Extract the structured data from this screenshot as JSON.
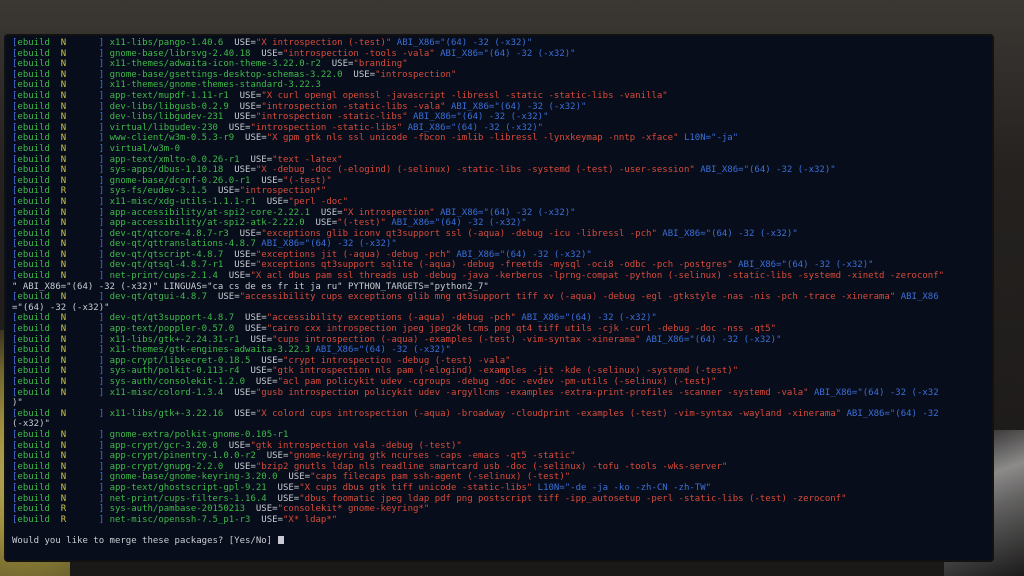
{
  "lines": [
    {
      "flag": "N",
      "pkg": "x11-libs/pango-1.40.6",
      "use": "\"X introspection (-test)\"",
      "abi": "ABI_X86=\"(64) -32 (-x32)\""
    },
    {
      "flag": "N",
      "pkg": "gnome-base/librsvg-2.40.18",
      "use": "\"introspection -tools -vala\"",
      "abi": "ABI_X86=\"(64) -32 (-x32)\""
    },
    {
      "flag": "N",
      "pkg": "x11-themes/adwaita-icon-theme-3.22.0-r2",
      "use": "\"branding\"",
      "abi": ""
    },
    {
      "flag": "N",
      "pkg": "gnome-base/gsettings-desktop-schemas-3.22.0",
      "use": "\"introspection\"",
      "abi": ""
    },
    {
      "flag": "N",
      "pkg": "x11-themes/gnome-themes-standard-3.22.3",
      "use": "",
      "abi": ""
    },
    {
      "flag": "N",
      "pkg": "app-text/mupdf-1.11-r1",
      "use": "\"X curl opengl openssl -javascript -libressl -static -static-libs -vanilla\"",
      "abi": ""
    },
    {
      "flag": "N",
      "pkg": "dev-libs/libgusb-0.2.9",
      "use": "\"introspection -static-libs -vala\"",
      "abi": "ABI_X86=\"(64) -32 (-x32)\""
    },
    {
      "flag": "N",
      "pkg": "dev-libs/libgudev-231",
      "use": "\"introspection -static-libs\"",
      "abi": "ABI_X86=\"(64) -32 (-x32)\""
    },
    {
      "flag": "N",
      "pkg": "virtual/libgudev-230",
      "use": "\"introspection -static-libs\"",
      "abi": "ABI_X86=\"(64) -32 (-x32)\""
    },
    {
      "flag": "N",
      "pkg": "www-client/w3m-0.5.3-r9",
      "use": "\"X gpm gtk nls ssl unicode -fbcon -imlib -libressl -lynxkeymap -nntp -xface\"",
      "abi": "L10N=\"-ja\""
    },
    {
      "flag": "N",
      "pkg": "virtual/w3m-0",
      "use": "",
      "abi": ""
    },
    {
      "flag": "N",
      "pkg": "app-text/xmlto-0.0.26-r1",
      "use": "\"text -latex\"",
      "abi": ""
    },
    {
      "flag": "N",
      "pkg": "sys-apps/dbus-1.10.18",
      "use": "\"X -debug -doc (-elogind) (-selinux) -static-libs -systemd (-test) -user-session\"",
      "abi": "ABI_X86=\"(64) -32 (-x32)\""
    },
    {
      "flag": "N",
      "pkg": "gnome-base/dconf-0.26.0-r1",
      "use": "\"(-test)\"",
      "abi": ""
    },
    {
      "flag": "R",
      "pkg": "sys-fs/eudev-3.1.5",
      "use": "\"introspection*\"",
      "abi": ""
    },
    {
      "flag": "N",
      "pkg": "x11-misc/xdg-utils-1.1.1-r1",
      "use": "\"perl -doc\"",
      "abi": ""
    },
    {
      "flag": "N",
      "pkg": "app-accessibility/at-spi2-core-2.22.1",
      "use": "\"X introspection\"",
      "abi": "ABI_X86=\"(64) -32 (-x32)\""
    },
    {
      "flag": "N",
      "pkg": "app-accessibility/at-spi2-atk-2.22.0",
      "use": "\"(-test)\"",
      "abi": "ABI_X86=\"(64) -32 (-x32)\""
    },
    {
      "flag": "N",
      "pkg": "dev-qt/qtcore-4.8.7-r3",
      "use": "\"exceptions glib iconv qt3support ssl (-aqua) -debug -icu -libressl -pch\"",
      "abi": "ABI_X86=\"(64) -32 (-x32)\""
    },
    {
      "flag": "N",
      "pkg": "dev-qt/qttranslations-4.8.7",
      "use": "",
      "abi": "ABI_X86=\"(64) -32 (-x32)\""
    },
    {
      "flag": "N",
      "pkg": "dev-qt/qtscript-4.8.7",
      "use": "\"exceptions jit (-aqua) -debug -pch\"",
      "abi": "ABI_X86=\"(64) -32 (-x32)\""
    },
    {
      "flag": "N",
      "pkg": "dev-qt/qtsql-4.8.7-r1",
      "use": "\"exceptions qt3support sqlite (-aqua) -debug -freetds -mysql -oci8 -odbc -pch -postgres\"",
      "abi": "ABI_X86=\"(64) -32 (-x32)\""
    },
    {
      "flag": "N",
      "pkg": "net-print/cups-2.1.4",
      "use": "\"X acl dbus pam ssl threads usb -debug -java -kerberos -lprng-compat -python (-selinux) -static-libs -systemd -xinetd -zeroconf\"",
      "abi": ""
    },
    {
      "cont": "\" ABI_X86=\"(64) -32 (-x32)\" LINGUAS=\"ca cs de es fr it ja ru\" PYTHON_TARGETS=\"python2_7\""
    },
    {
      "flag": "N",
      "pkg": "dev-qt/qtgui-4.8.7",
      "use": "\"accessibility cups exceptions glib mng qt3support tiff xv (-aqua) -debug -egl -gtkstyle -nas -nis -pch -trace -xinerama\"",
      "abi": "ABI_X86"
    },
    {
      "cont": "=\"(64) -32 (-x32)\""
    },
    {
      "flag": "N",
      "pkg": "dev-qt/qt3support-4.8.7",
      "use": "\"accessibility exceptions (-aqua) -debug -pch\"",
      "abi": "ABI_X86=\"(64) -32 (-x32)\""
    },
    {
      "flag": "N",
      "pkg": "app-text/poppler-0.57.0",
      "use": "\"cairo cxx introspection jpeg jpeg2k lcms png qt4 tiff utils -cjk -curl -debug -doc -nss -qt5\"",
      "abi": ""
    },
    {
      "flag": "N",
      "pkg": "x11-libs/gtk+-2.24.31-r1",
      "use": "\"cups introspection (-aqua) -examples (-test) -vim-syntax -xinerama\"",
      "abi": "ABI_X86=\"(64) -32 (-x32)\""
    },
    {
      "flag": "N",
      "pkg": "x11-themes/gtk-engines-adwaita-3.22.3",
      "use": "",
      "abi": "ABI_X86=\"(64) -32 (-x32)\""
    },
    {
      "flag": "N",
      "pkg": "app-crypt/libsecret-0.18.5",
      "use": "\"crypt introspection -debug (-test) -vala\"",
      "abi": ""
    },
    {
      "flag": "N",
      "pkg": "sys-auth/polkit-0.113-r4",
      "use": "\"gtk introspection nls pam (-elogind) -examples -jit -kde (-selinux) -systemd (-test)\"",
      "abi": ""
    },
    {
      "flag": "N",
      "pkg": "sys-auth/consolekit-1.2.0",
      "use": "\"acl pam policykit udev -cgroups -debug -doc -evdev -pm-utils (-selinux) (-test)\"",
      "abi": ""
    },
    {
      "flag": "N",
      "pkg": "x11-misc/colord-1.3.4",
      "use": "\"gusb introspection policykit udev -argyllcms -examples -extra-print-profiles -scanner -systemd -vala\"",
      "abi": "ABI_X86=\"(64) -32 (-x32"
    },
    {
      "cont": ")\""
    },
    {
      "flag": "N",
      "pkg": "x11-libs/gtk+-3.22.16",
      "use": "\"X colord cups introspection (-aqua) -broadway -cloudprint -examples (-test) -vim-syntax -wayland -xinerama\"",
      "abi": "ABI_X86=\"(64) -32"
    },
    {
      "cont": "(-x32)\""
    },
    {
      "flag": "N",
      "pkg": "gnome-extra/polkit-gnome-0.105-r1",
      "use": "",
      "abi": ""
    },
    {
      "flag": "N",
      "pkg": "app-crypt/gcr-3.20.0",
      "use": "\"gtk introspection vala -debug (-test)\"",
      "abi": ""
    },
    {
      "flag": "N",
      "pkg": "app-crypt/pinentry-1.0.0-r2",
      "use": "\"gnome-keyring gtk ncurses -caps -emacs -qt5 -static\"",
      "abi": ""
    },
    {
      "flag": "N",
      "pkg": "app-crypt/gnupg-2.2.0",
      "use": "\"bzip2 gnutls ldap nls readline smartcard usb -doc (-selinux) -tofu -tools -wks-server\"",
      "abi": ""
    },
    {
      "flag": "N",
      "pkg": "gnome-base/gnome-keyring-3.20.0",
      "use": "\"caps filecaps pam ssh-agent (-selinux) (-test)\"",
      "abi": ""
    },
    {
      "flag": "N",
      "pkg": "app-text/ghostscript-gpl-9.21",
      "use": "\"X cups dbus gtk tiff unicode -static-libs\"",
      "abi": "L10N=\"-de -ja -ko -zh-CN -zh-TW\""
    },
    {
      "flag": "N",
      "pkg": "net-print/cups-filters-1.16.4",
      "use": "\"dbus foomatic jpeg ldap pdf png postscript tiff -ipp_autosetup -perl -static-libs (-test) -zeroconf\"",
      "abi": ""
    },
    {
      "flag": "R",
      "pkg": "sys-auth/pambase-20150213",
      "use": "\"consolekit* gnome-keyring*\"",
      "abi": ""
    },
    {
      "flag": "R",
      "pkg": "net-misc/openssh-7.5_p1-r3",
      "use": "\"X* ldap*\"",
      "abi": ""
    }
  ],
  "ebuild_label": "ebuild",
  "use_label": "USE=",
  "prompt": "Would you like to merge these packages? [Yes/No]"
}
